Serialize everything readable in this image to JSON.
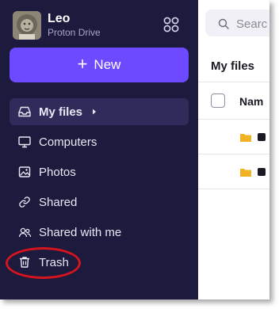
{
  "header": {
    "user_name": "Leo",
    "app_name": "Proton Drive"
  },
  "sidebar": {
    "new_button_label": "New",
    "items": [
      {
        "label": "My files",
        "icon": "inbox-icon",
        "active": true
      },
      {
        "label": "Computers",
        "icon": "monitor-icon",
        "active": false
      },
      {
        "label": "Photos",
        "icon": "image-icon",
        "active": false
      },
      {
        "label": "Shared",
        "icon": "link-icon",
        "active": false
      },
      {
        "label": "Shared with me",
        "icon": "users-icon",
        "active": false
      },
      {
        "label": "Trash",
        "icon": "trash-icon",
        "active": false
      }
    ]
  },
  "main": {
    "search_placeholder": "Searc",
    "section_title": "My files",
    "column_name": "Nam"
  },
  "colors": {
    "sidebar_bg": "#1c1a3d",
    "accent": "#6d4aff",
    "active_item_bg": "#2f2b5a",
    "folder": "#f0b323",
    "highlight_ring": "#d6141e"
  }
}
